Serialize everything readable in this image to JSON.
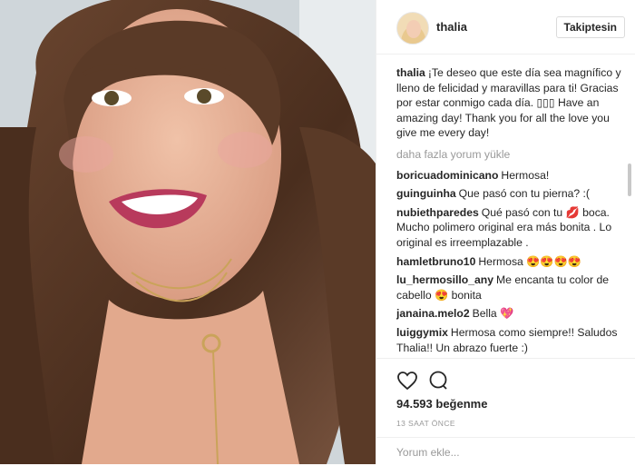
{
  "post": {
    "username": "thalia",
    "follow_label": "Takiptesin",
    "caption": "¡Te deseo que este día sea magnífico y lleno de felicidad y maravillas para ti! Gracias por estar conmigo cada día. ▯▯▯ Have an amazing day! Thank you for all the love you give me every day!",
    "load_more": "daha fazla yorum yükle",
    "comments": [
      {
        "user": "boricuadominicano",
        "text": "Hermosa!"
      },
      {
        "user": "guinguinha",
        "text": "Que pasó con tu pierna? :("
      },
      {
        "user": "nubiethparedes",
        "text": "Qué pasó con tu 💋 boca. Mucho polimero original era más bonita . Lo original es irreemplazable ."
      },
      {
        "user": "hamletbruno10",
        "text": "Hermosa 😍😍😍😍"
      },
      {
        "user": "lu_hermosillo_any",
        "text": "Me encanta tu color de cabello 😍 bonita"
      },
      {
        "user": "janaina.melo2",
        "text": "Bella 💖"
      },
      {
        "user": "luiggymix",
        "text": "Hermosa como siempre!! Saludos Thalia!! Un abrazo fuerte :)"
      }
    ],
    "likes": "94.593 beğenme",
    "time_ago": "13 SAAT ÖNCE",
    "comment_placeholder": "Yorum ekle...",
    "icons": {
      "like": "heart-icon",
      "comment": "comment-bubble-icon"
    }
  },
  "colors": {
    "text": "#262626",
    "muted": "#999999",
    "border": "#efefef"
  }
}
